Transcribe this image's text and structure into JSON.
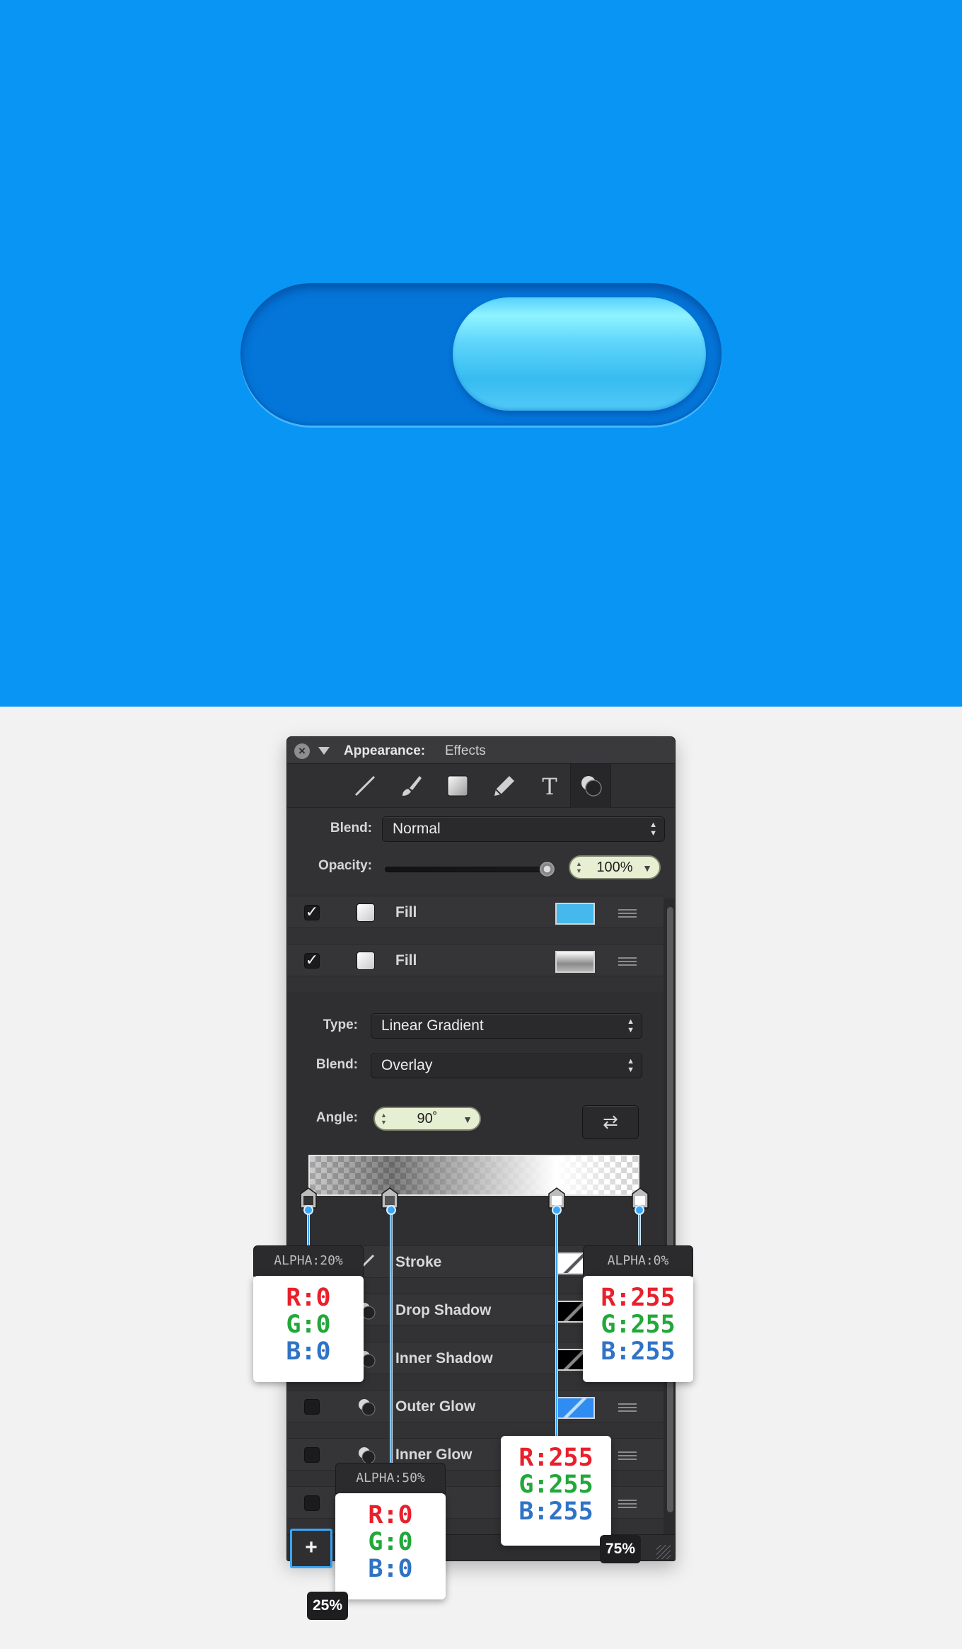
{
  "preview": {
    "background_color": "#0895f3",
    "toggle_track_color": "#0476d9",
    "toggle_knob_color": "#5ed5fb"
  },
  "panel": {
    "title": "Appearance:",
    "subtitle": "Effects",
    "toolbar_icons": [
      "line-icon",
      "brush-icon",
      "square-icon",
      "pencil-icon",
      "text-icon",
      "effects-icon"
    ],
    "blend_label": "Blend:",
    "blend_value": "Normal",
    "opacity_label": "Opacity:",
    "opacity_value": "100%",
    "opacity_level": 1.0,
    "fills": [
      {
        "label": "Fill",
        "checked": true,
        "checkmark": "✓",
        "swatch_color": "#45b8ec"
      },
      {
        "label": "Fill",
        "checked": true,
        "checkmark": "✓",
        "swatch_color": "gradient"
      }
    ],
    "gradient": {
      "type_label": "Type:",
      "type_value": "Linear Gradient",
      "blend_label": "Blend:",
      "blend_value": "Overlay",
      "angle_label": "Angle:",
      "angle_value": "90˚",
      "swap_icon": "swap-icon"
    },
    "effects": [
      {
        "label": "Stroke",
        "icon": "stroke-icon"
      },
      {
        "label": "Drop Shadow",
        "icon": "shadow-icon"
      },
      {
        "label": "Inner Shadow",
        "icon": "shadow-icon"
      },
      {
        "label": "Outer Glow",
        "icon": "glow-icon"
      },
      {
        "label": "Inner Glow",
        "icon": "glow-icon"
      }
    ],
    "add_label": "+"
  },
  "callouts": [
    {
      "alpha": "ALPHA:20%",
      "r": "R:0",
      "g": "G:0",
      "b": "B:0"
    },
    {
      "alpha": "ALPHA:50%",
      "r": "R:0",
      "g": "G:0",
      "b": "B:0"
    },
    {
      "alpha": "",
      "r": "R:255",
      "g": "G:255",
      "b": "B:255"
    },
    {
      "alpha": "ALPHA:0%",
      "r": "R:255",
      "g": "G:255",
      "b": "B:255"
    }
  ],
  "stop_badges": {
    "left": "25%",
    "right": "75%"
  },
  "colors": {
    "accent": "#3aa6f8",
    "red": "#e8202c",
    "green": "#21a83a",
    "blue": "#2f73c6"
  }
}
